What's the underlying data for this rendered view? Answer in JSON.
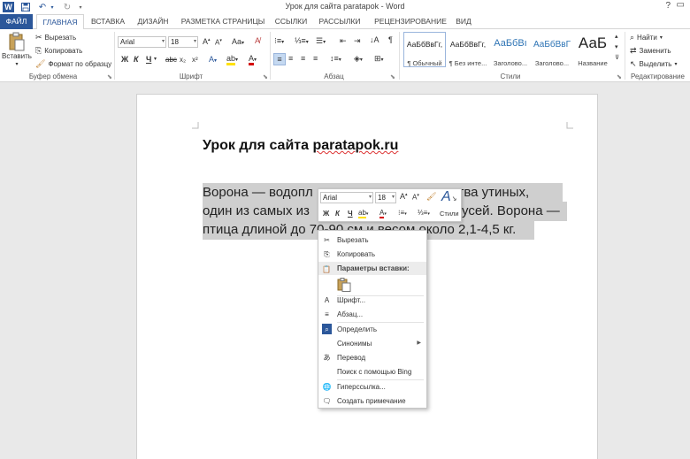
{
  "window": {
    "title": "Урок для сайта paratapok - Word",
    "help": "?",
    "app_letter": "W"
  },
  "tabs": [
    {
      "label": "ФАЙЛ"
    },
    {
      "label": "ГЛАВНАЯ"
    },
    {
      "label": "ВСТАВКА"
    },
    {
      "label": "ДИЗАЙН"
    },
    {
      "label": "РАЗМЕТКА СТРАНИЦЫ"
    },
    {
      "label": "ССЫЛКИ"
    },
    {
      "label": "РАССЫЛКИ"
    },
    {
      "label": "РЕЦЕНЗИРОВАНИЕ"
    },
    {
      "label": "ВИД"
    }
  ],
  "clipboard": {
    "paste": "Вставить",
    "cut": "Вырезать",
    "copy": "Копировать",
    "format_painter": "Формат по образцу",
    "group": "Буфер обмена"
  },
  "font": {
    "name": "Arial",
    "size": "18",
    "grow": "A",
    "shrink": "A",
    "case": "Aa",
    "bold": "Ж",
    "italic": "К",
    "underline": "Ч",
    "strike": "abc",
    "subscript": "x₂",
    "superscript": "x²",
    "group": "Шрифт"
  },
  "paragraph": {
    "group": "Абзац",
    "pilcrow": "¶"
  },
  "styles": {
    "group": "Стили",
    "items": [
      {
        "preview": "АаБбВвГг,",
        "name": "¶ Обычный"
      },
      {
        "preview": "АаБбВвГг,",
        "name": "¶ Без инте..."
      },
      {
        "preview": "АаБбВı",
        "name": "Заголово..."
      },
      {
        "preview": "АаБбВвГ",
        "name": "Заголово..."
      },
      {
        "preview": "АаБ",
        "name": "Название"
      }
    ]
  },
  "editing": {
    "find": "Найти",
    "replace": "Заменить",
    "select": "Выделить",
    "group": "Редактирование"
  },
  "document": {
    "heading_prefix": "Урок для сайта ",
    "heading_link": "paratapok.ru",
    "line1_a": "Ворона — водопл",
    "line1_b": "ства утиных,",
    "line2_a": "один из самых из",
    "line2_b": "усей. Ворона —",
    "line3": "птица длиной до 70-90 см и весом около 2,1-4,5 кг."
  },
  "minibar": {
    "font": "Arial",
    "size": "18",
    "bold": "Ж",
    "italic": "К",
    "underline": "Ч",
    "styles": "Стили"
  },
  "context_menu": {
    "cut": "Вырезать",
    "copy": "Копировать",
    "paste_header": "Параметры вставки:",
    "font": "Шрифт...",
    "paragraph": "Абзац...",
    "define": "Определить",
    "synonyms": "Синонимы",
    "translate": "Перевод",
    "bing": "Поиск с помощью Bing",
    "hyperlink": "Гиперссылка...",
    "comment": "Создать примечание"
  },
  "colors": {
    "accent": "#2b579a",
    "selection": "#cfcfcf",
    "font_color": "#d40000",
    "highlight": "#ffe100"
  }
}
